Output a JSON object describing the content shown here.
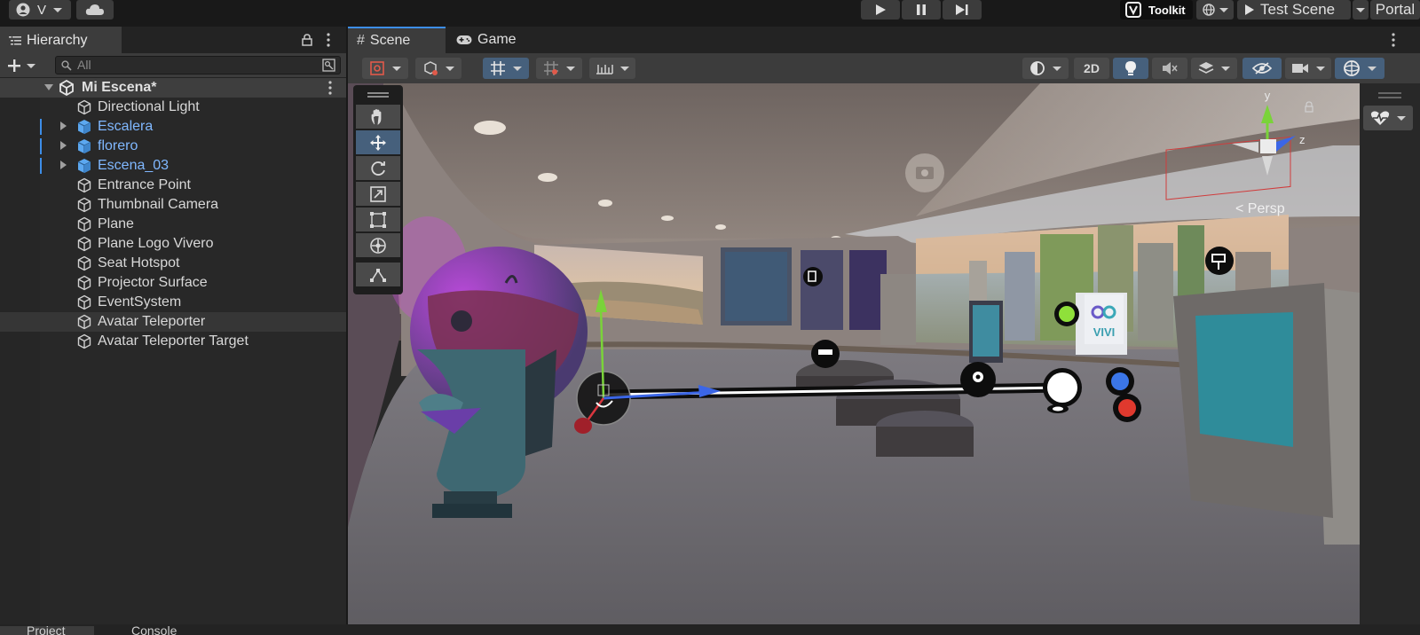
{
  "topbar": {
    "account_label": "V",
    "toolkit_label": "Toolkit",
    "test_scene_label": "Test Scene",
    "portal_label": "Portal"
  },
  "hierarchy": {
    "tab_label": "Hierarchy",
    "search_placeholder": "All",
    "scene_name": "Mi Escena*",
    "items": [
      {
        "label": "Directional Light",
        "prefab": false,
        "expandable": false
      },
      {
        "label": "Escalera",
        "prefab": true,
        "expandable": true
      },
      {
        "label": "florero",
        "prefab": true,
        "expandable": true
      },
      {
        "label": "Escena_03",
        "prefab": true,
        "expandable": true
      },
      {
        "label": "Entrance Point",
        "prefab": false,
        "expandable": false
      },
      {
        "label": "Thumbnail Camera",
        "prefab": false,
        "expandable": false
      },
      {
        "label": "Plane",
        "prefab": false,
        "expandable": false
      },
      {
        "label": "Plane Logo Vivero",
        "prefab": false,
        "expandable": false
      },
      {
        "label": "Seat Hotspot",
        "prefab": false,
        "expandable": false
      },
      {
        "label": "Projector Surface",
        "prefab": false,
        "expandable": false
      },
      {
        "label": "EventSystem",
        "prefab": false,
        "expandable": false
      },
      {
        "label": "Avatar Teleporter",
        "prefab": false,
        "expandable": false,
        "selected": true
      },
      {
        "label": "Avatar Teleporter Target",
        "prefab": false,
        "expandable": false
      }
    ]
  },
  "scene": {
    "tab_scene": "Scene",
    "tab_game": "Game",
    "btn_2d": "2D",
    "persp_label": "< Persp",
    "gizmo_y": "y",
    "gizmo_z": "z",
    "vivi_label": "VIVI"
  },
  "colors": {
    "panel_bg": "#282828",
    "toolbar_bg": "#3c3c3c",
    "active_blue": "#46607c",
    "prefab_blue": "#80b8ff",
    "gizmo_y": "#7ad33a",
    "gizmo_x": "#d9363e",
    "gizmo_z": "#3b66e6"
  },
  "bottom": {
    "tab_project": "Project",
    "tab_console": "Console"
  }
}
